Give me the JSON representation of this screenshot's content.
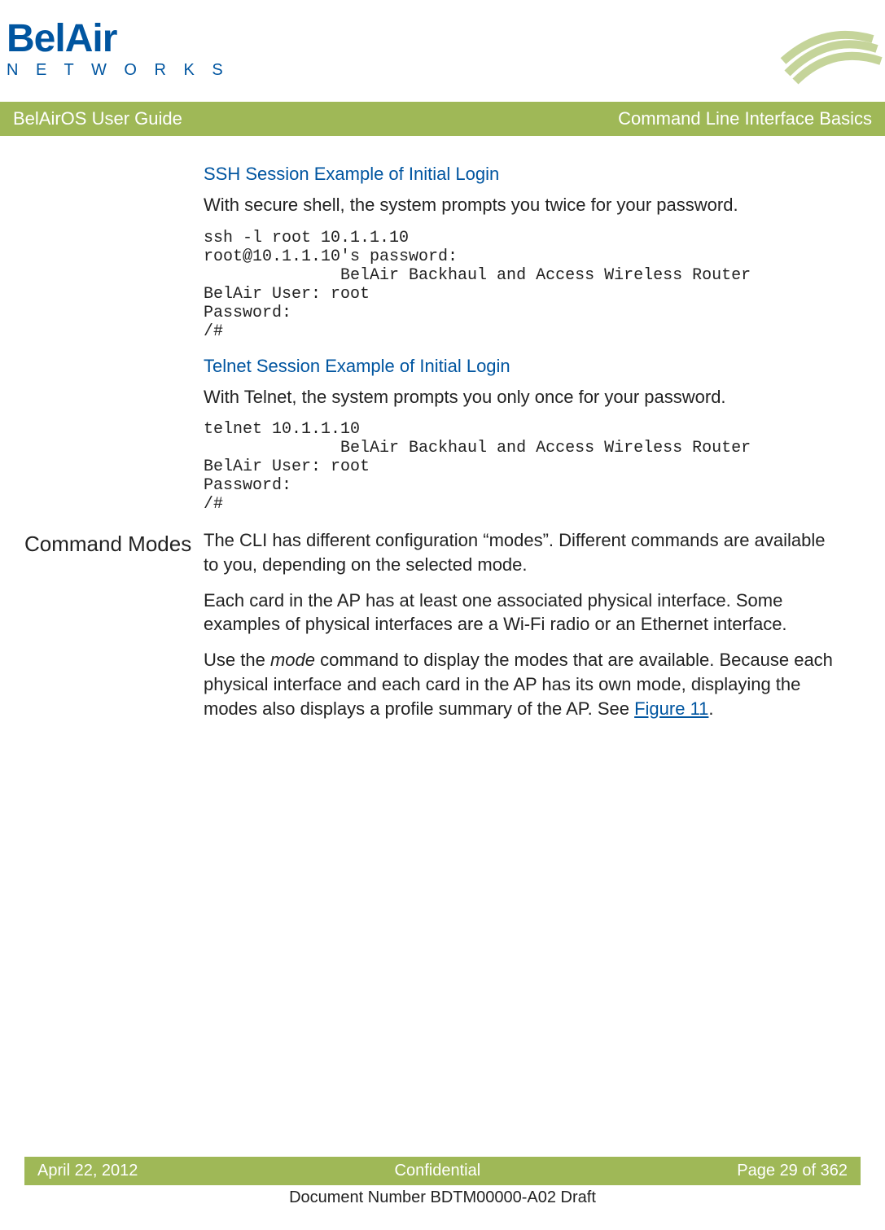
{
  "logo": {
    "main": "BelAir",
    "sub": "N E T W O R K S"
  },
  "titlebar": {
    "left": "BelAirOS User Guide",
    "right": "Command Line Interface Basics"
  },
  "ssh": {
    "heading": "SSH Session Example of Initial Login",
    "intro": "With secure shell, the system prompts you twice for your password.",
    "code": "ssh -l root 10.1.1.10\nroot@10.1.1.10's password:\n              BelAir Backhaul and Access Wireless Router\nBelAir User: root\nPassword:\n/#"
  },
  "telnet": {
    "heading": "Telnet Session Example of Initial Login",
    "intro": "With Telnet, the system prompts you only once for your password.",
    "code": "telnet 10.1.1.10\n              BelAir Backhaul and Access Wireless Router\nBelAir User: root\nPassword:\n/#"
  },
  "modes": {
    "heading": "Command Modes",
    "p1": "The CLI has different configuration “modes”. Different commands are available to you, depending on the selected mode.",
    "p2": "Each card in the AP has at least one associated physical interface. Some examples of physical interfaces are a Wi-Fi radio or an Ethernet interface.",
    "p3a": "Use the ",
    "p3_mode": "mode",
    "p3b": " command to display the modes that are available. Because each physical interface and each card in the AP has its own mode, displaying the modes also displays a profile summary of the AP. See ",
    "p3_link": "Figure 11",
    "p3c": "."
  },
  "footer": {
    "date": "April 22, 2012",
    "center": "Confidential",
    "page": "Page 29 of 362",
    "docnum": "Document Number BDTM00000-A02 Draft"
  }
}
